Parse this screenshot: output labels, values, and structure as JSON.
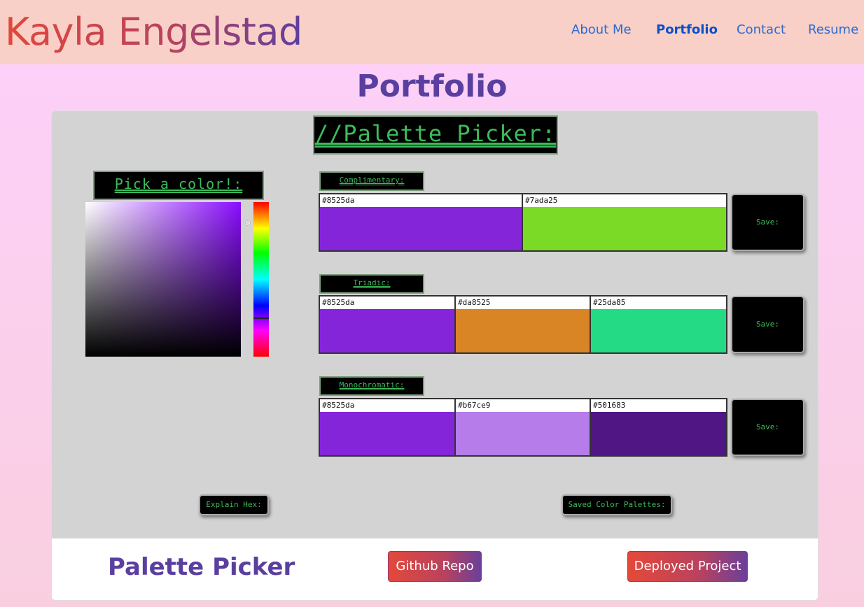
{
  "header": {
    "brand": "Kayla Engelstad",
    "nav": [
      {
        "label": "About Me"
      },
      {
        "label": "Portfolio"
      },
      {
        "label": "Contact"
      },
      {
        "label": "Resume"
      }
    ],
    "active_nav": "Portfolio"
  },
  "page": {
    "title": "Portfolio"
  },
  "app": {
    "title": "//Palette Picker:",
    "picker_label": "Pick a color!:",
    "selected_hue_color": "#8a0dff",
    "sections": [
      {
        "label": "Complimentary:",
        "save_label": "Save:",
        "swatches": [
          {
            "hex": "#8525da",
            "color": "#8525da"
          },
          {
            "hex": "#7ada25",
            "color": "#7ada25"
          }
        ]
      },
      {
        "label": "Triadic:",
        "save_label": "Save:",
        "swatches": [
          {
            "hex": "#8525da",
            "color": "#8525da"
          },
          {
            "hex": "#da8525",
            "color": "#da8525"
          },
          {
            "hex": "#25da85",
            "color": "#25da85"
          }
        ]
      },
      {
        "label": "Monochromatic:",
        "save_label": "Save:",
        "swatches": [
          {
            "hex": "#8525da",
            "color": "#8525da"
          },
          {
            "hex": "#b67ce9",
            "color": "#b67ce9"
          },
          {
            "hex": "#501683",
            "color": "#501683"
          }
        ]
      }
    ],
    "explain_label": "Explain Hex:",
    "saved_label": "Saved Color Palettes:"
  },
  "footer": {
    "project_name": "Palette Picker",
    "github_label": "Github Repo",
    "deployed_label": "Deployed Project"
  }
}
